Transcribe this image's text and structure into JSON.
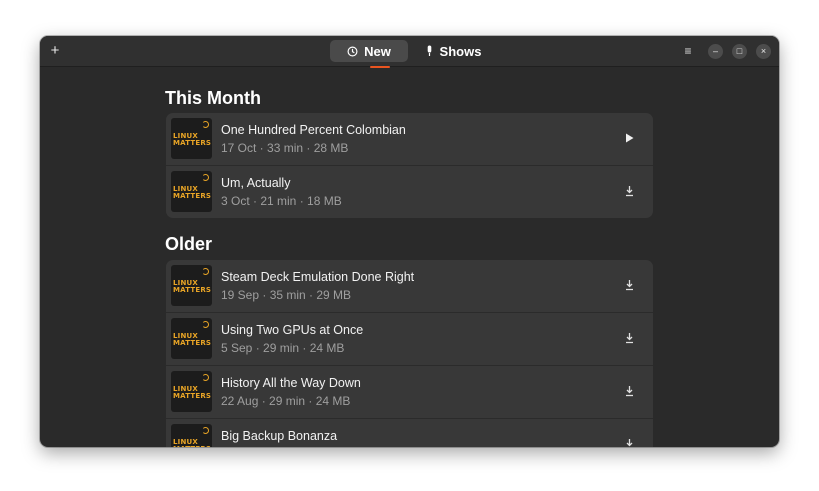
{
  "header": {
    "add_icon": "+",
    "tabs": [
      {
        "label": "New",
        "icon": "clock-icon"
      },
      {
        "label": "Shows",
        "icon": "microphone-icon"
      }
    ],
    "menu_icon": "≡",
    "minimize_icon": "–",
    "maximize_icon": "□",
    "close_icon": "×"
  },
  "sections": {
    "this_month": {
      "title": "This Month",
      "episodes": [
        {
          "title": "One Hundred Percent Colombian",
          "meta": "17 Oct · 33 min · 28 MB",
          "action": "play"
        },
        {
          "title": "Um, Actually",
          "meta": "3 Oct · 21 min · 18 MB",
          "action": "download"
        }
      ]
    },
    "older": {
      "title": "Older",
      "episodes": [
        {
          "title": "Steam Deck Emulation Done Right",
          "meta": "19 Sep · 35 min · 29 MB",
          "action": "download"
        },
        {
          "title": "Using Two GPUs at Once",
          "meta": "5 Sep · 29 min · 24 MB",
          "action": "download"
        },
        {
          "title": "History All the Way Down",
          "meta": "22 Aug · 29 min · 24 MB",
          "action": "download"
        },
        {
          "title": "Big Backup Bonanza",
          "meta": "",
          "action": "download"
        }
      ]
    }
  },
  "thumbnail": {
    "line1": "LINUX",
    "line2": "MATTERS"
  },
  "colors": {
    "accent": "#e95420",
    "thumb_text": "#e9a526",
    "bg": "#2a2a2a",
    "card": "#383838"
  }
}
